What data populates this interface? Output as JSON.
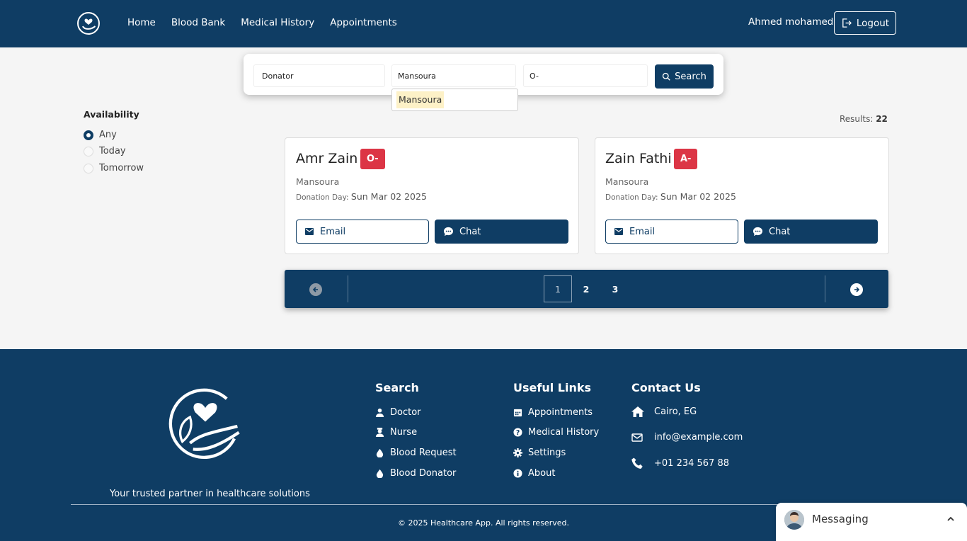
{
  "colors": {
    "brand": "#0f3d64",
    "badge": "#dc3545",
    "highlight": "#fdf1c7"
  },
  "header": {
    "logo_icon": "heart-hand-logo",
    "nav": [
      "Home",
      "Blood Bank",
      "Medical History",
      "Appointments"
    ],
    "user_name": "Ahmed mohamed",
    "logout_label": "Logout"
  },
  "search": {
    "type_value": "Donator",
    "city_value": "Mansoura",
    "blood_value": "O-",
    "button_label": "Search",
    "dropdown_option": "Mansoura"
  },
  "filters": {
    "title": "Availability",
    "options": [
      "Any",
      "Today",
      "Tomorrow"
    ],
    "selected": "Any"
  },
  "results": {
    "label": "Results:",
    "count": "22"
  },
  "cards": [
    {
      "name": "Amr Zain",
      "blood": "O-",
      "city": "Mansoura",
      "day_label": "Donation Day:",
      "day": "Sun Mar 02 2025",
      "email_label": "Email",
      "chat_label": "Chat"
    },
    {
      "name": "Zain Fathi",
      "blood": "A-",
      "city": "Mansoura",
      "day_label": "Donation Day:",
      "day": "Sun Mar 02 2025",
      "email_label": "Email",
      "chat_label": "Chat"
    }
  ],
  "pagination": {
    "pages": [
      "1",
      "2",
      "3"
    ],
    "current": "1"
  },
  "footer": {
    "tagline": "Your trusted partner in healthcare solutions",
    "search_title": "Search",
    "search_links": [
      "Doctor",
      "Nurse",
      "Blood Request",
      "Blood Donator"
    ],
    "useful_title": "Useful Links",
    "useful_links": [
      "Appointments",
      "Medical History",
      "Settings",
      "About"
    ],
    "contact_title": "Contact Us",
    "contact": [
      "Cairo, EG",
      "info@example.com",
      "+01 234 567 88"
    ],
    "copyright": "© 2025 Healthcare App. All rights reserved."
  },
  "messaging": {
    "label": "Messaging"
  }
}
